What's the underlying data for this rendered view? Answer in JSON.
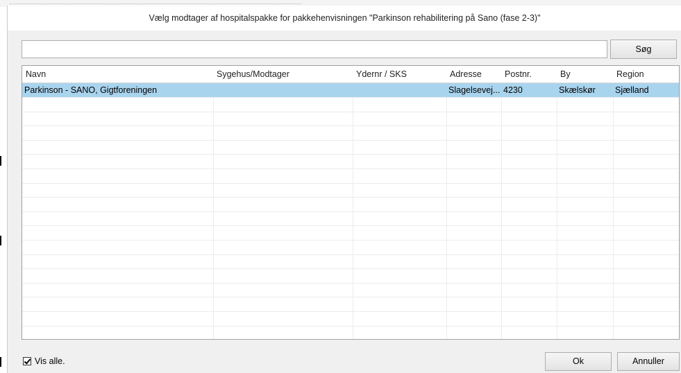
{
  "dialog": {
    "title": "Vælg modtager af hospitalspakke for pakkehenvisningen \"Parkinson rehabilitering på Sano (fase 2-3)\"",
    "search": {
      "value": "",
      "placeholder": "",
      "button_label": "Søg"
    },
    "table": {
      "columns": [
        "Navn",
        "Sygehus/Modtager",
        "Ydernr / SKS",
        "Adresse",
        "Postnr.",
        "By",
        "Region"
      ],
      "rows": [
        [
          "Parkinson - SANO, Gigtforeningen",
          "",
          "",
          "Slagelsevej...",
          "4230",
          "Skælskør",
          "Sjælland"
        ]
      ],
      "selected_row": 0
    },
    "show_all": {
      "label": "Vis alle.",
      "checked": true
    },
    "ok_label": "Ok",
    "cancel_label": "Annuller"
  },
  "colors": {
    "selection": "#a9d4ee",
    "dialog_bg": "#f0f0f0",
    "grid_line": "#ececec"
  }
}
